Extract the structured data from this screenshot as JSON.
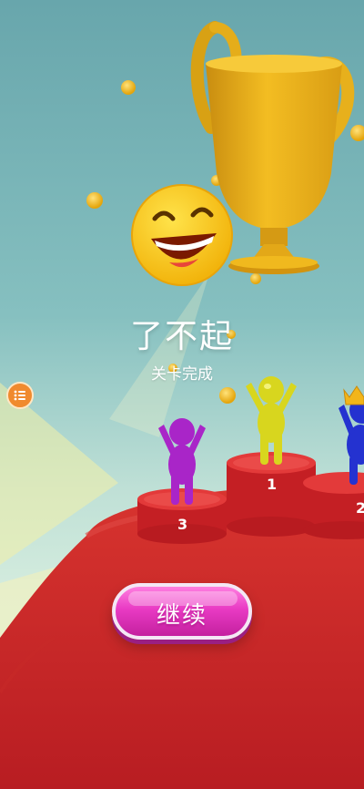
{
  "result": {
    "title": "了不起",
    "subtitle": "关卡完成"
  },
  "podium": {
    "first_label": "1",
    "second_label": "2",
    "third_label": "3"
  },
  "players": [
    {
      "place": "first",
      "color": "#d8d61e"
    },
    {
      "place": "second",
      "color": "#2432d0"
    },
    {
      "place": "third",
      "color": "#a925c8"
    }
  ],
  "buttons": {
    "continue_label": "继续"
  },
  "icons": {
    "menu": "list-menu-icon",
    "trophy": "trophy-icon",
    "emoji": "laughing-face-emoji",
    "crown": "crown-icon"
  },
  "colors": {
    "trophy_gold": "#f0b91e",
    "podium_red": "#d42a2a",
    "continue_button": "#e93bc4",
    "menu_button": "#f08a2e"
  }
}
